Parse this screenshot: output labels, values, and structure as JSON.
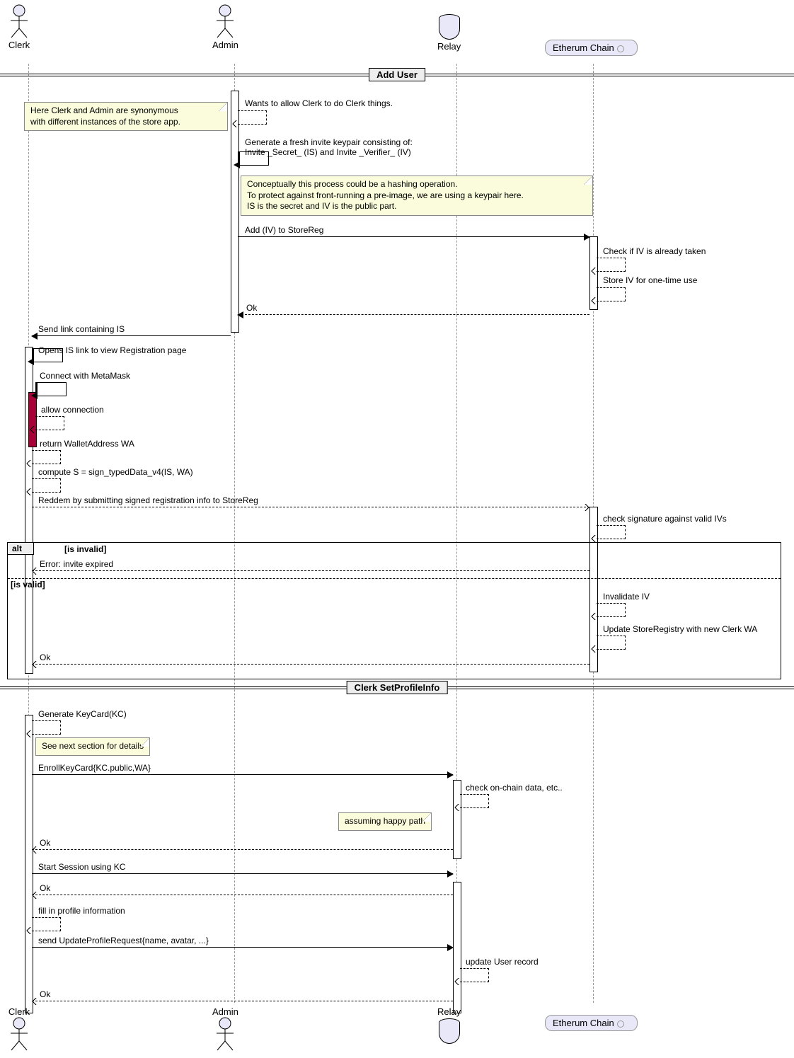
{
  "actors": {
    "clerk": "Clerk",
    "admin": "Admin",
    "relay": "Relay",
    "chain": "Etherum Chain"
  },
  "groups": {
    "addUser": "Add User",
    "setProfile": "Clerk SetProfileInfo"
  },
  "messages": {
    "m1": "Wants to allow Clerk to do Clerk things.",
    "m2a": "Generate a fresh invite keypair consisting of:",
    "m2b": "Invite _Secret_ (IS) and Invite _Verifier_ (IV)",
    "m3": "Add (IV) to StoreReg",
    "m4": "Check if IV is already taken",
    "m5": "Store IV for one-time use",
    "m6": "Ok",
    "m7": "Send link containing IS",
    "m8": "Opens IS link to view Registration page",
    "m9": "Connect with MetaMask",
    "m10": "allow connection",
    "m11": "return WalletAddress WA",
    "m12": "compute S = sign_typedData_v4(IS, WA)",
    "m13": "Reddem by submitting signed registration info to StoreReg",
    "m14": "check signature against valid IVs",
    "m15": "Error: invite expired",
    "m16": "Invalidate IV",
    "m17": "Update StoreRegistry with new Clerk WA",
    "m18": "Ok",
    "m19": "Generate KeyCard(KC)",
    "m20": "EnrollKeyCard{KC.public,WA}",
    "m21": "check on-chain data, etc..",
    "m22": "Ok",
    "m23": "Start Session using KC",
    "m24": "Ok",
    "m25": "fill in profile information",
    "m26": "send UpdateProfileRequest{name, avatar, ...}",
    "m27": "update User record",
    "m28": "Ok"
  },
  "notes": {
    "n1a": "Here Clerk and Admin are synonymous",
    "n1b": "with different instances of the store app.",
    "n2a": "Conceptually this process could be a hashing operation.",
    "n2b": "To protect against front-running a pre-image, we are using a keypair here.",
    "n2c": "IS is the secret and IV is the public part.",
    "n3": "See next section for details",
    "n4": "assuming happy path"
  },
  "alt": {
    "tag": "alt",
    "cond1": "[is invalid]",
    "cond2": "[is valid]"
  },
  "chart_data": {
    "type": "sequence-diagram",
    "participants": [
      {
        "id": "clerk",
        "label": "Clerk",
        "kind": "actor"
      },
      {
        "id": "admin",
        "label": "Admin",
        "kind": "actor"
      },
      {
        "id": "relay",
        "label": "Relay",
        "kind": "database"
      },
      {
        "id": "chain",
        "label": "Etherum Chain",
        "kind": "entity"
      }
    ],
    "groups": [
      {
        "title": "Add User",
        "steps": [
          {
            "from": "admin",
            "to": "admin",
            "text": "Wants to allow Clerk to do Clerk things.",
            "style": "dashed"
          },
          {
            "note": "Here Clerk and Admin are synonymous with different instances of the store app.",
            "near": "admin",
            "side": "left"
          },
          {
            "from": "admin",
            "to": "admin",
            "text": "Generate a fresh invite keypair consisting of: Invite _Secret_ (IS) and Invite _Verifier_ (IV)",
            "style": "solid"
          },
          {
            "note": "Conceptually this process could be a hashing operation. To protect against front-running a pre-image, we are using a keypair here. IS is the secret and IV is the public part.",
            "near": "admin",
            "side": "right"
          },
          {
            "from": "admin",
            "to": "chain",
            "text": "Add (IV) to StoreReg",
            "style": "solid"
          },
          {
            "from": "chain",
            "to": "chain",
            "text": "Check if IV is already taken",
            "style": "dashed"
          },
          {
            "from": "chain",
            "to": "chain",
            "text": "Store IV for one-time use",
            "style": "dashed"
          },
          {
            "from": "chain",
            "to": "admin",
            "text": "Ok",
            "style": "dashed"
          },
          {
            "from": "admin",
            "to": "clerk",
            "text": "Send link containing IS",
            "style": "solid"
          },
          {
            "from": "clerk",
            "to": "clerk",
            "text": "Opens IS link to view Registration page",
            "style": "solid"
          },
          {
            "from": "clerk",
            "to": "clerk",
            "text": "Connect with MetaMask",
            "style": "solid"
          },
          {
            "from": "clerk",
            "to": "clerk",
            "text": "allow connection",
            "style": "dashed"
          },
          {
            "from": "clerk",
            "to": "clerk",
            "text": "return WalletAddress WA",
            "style": "dashed"
          },
          {
            "from": "clerk",
            "to": "clerk",
            "text": "compute S = sign_typedData_v4(IS, WA)",
            "style": "dashed"
          },
          {
            "from": "clerk",
            "to": "chain",
            "text": "Reddem by submitting signed registration info to StoreReg",
            "style": "dashed"
          },
          {
            "from": "chain",
            "to": "chain",
            "text": "check signature against valid IVs",
            "style": "dashed"
          },
          {
            "alt": [
              {
                "guard": "is invalid",
                "steps": [
                  {
                    "from": "chain",
                    "to": "clerk",
                    "text": "Error: invite expired",
                    "style": "dashed"
                  }
                ]
              },
              {
                "guard": "is valid",
                "steps": [
                  {
                    "from": "chain",
                    "to": "chain",
                    "text": "Invalidate IV",
                    "style": "dashed"
                  },
                  {
                    "from": "chain",
                    "to": "chain",
                    "text": "Update StoreRegistry with new Clerk WA",
                    "style": "dashed"
                  },
                  {
                    "from": "chain",
                    "to": "clerk",
                    "text": "Ok",
                    "style": "dashed"
                  }
                ]
              }
            ]
          }
        ]
      },
      {
        "title": "Clerk SetProfileInfo",
        "steps": [
          {
            "from": "clerk",
            "to": "clerk",
            "text": "Generate KeyCard(KC)",
            "style": "dashed"
          },
          {
            "note": "See next section for details",
            "near": "clerk",
            "side": "right"
          },
          {
            "from": "clerk",
            "to": "relay",
            "text": "EnrollKeyCard{KC.public,WA}",
            "style": "solid"
          },
          {
            "from": "relay",
            "to": "relay",
            "text": "check on-chain data, etc..",
            "style": "dashed"
          },
          {
            "note": "assuming happy path",
            "near": "relay",
            "side": "left"
          },
          {
            "from": "relay",
            "to": "clerk",
            "text": "Ok",
            "style": "dashed"
          },
          {
            "from": "clerk",
            "to": "relay",
            "text": "Start Session using KC",
            "style": "solid"
          },
          {
            "from": "relay",
            "to": "clerk",
            "text": "Ok",
            "style": "dashed"
          },
          {
            "from": "clerk",
            "to": "clerk",
            "text": "fill in profile information",
            "style": "dashed"
          },
          {
            "from": "clerk",
            "to": "relay",
            "text": "send UpdateProfileRequest{name, avatar, ...}",
            "style": "solid"
          },
          {
            "from": "relay",
            "to": "relay",
            "text": "update User record",
            "style": "dashed"
          },
          {
            "from": "relay",
            "to": "clerk",
            "text": "Ok",
            "style": "dashed"
          }
        ]
      }
    ]
  }
}
